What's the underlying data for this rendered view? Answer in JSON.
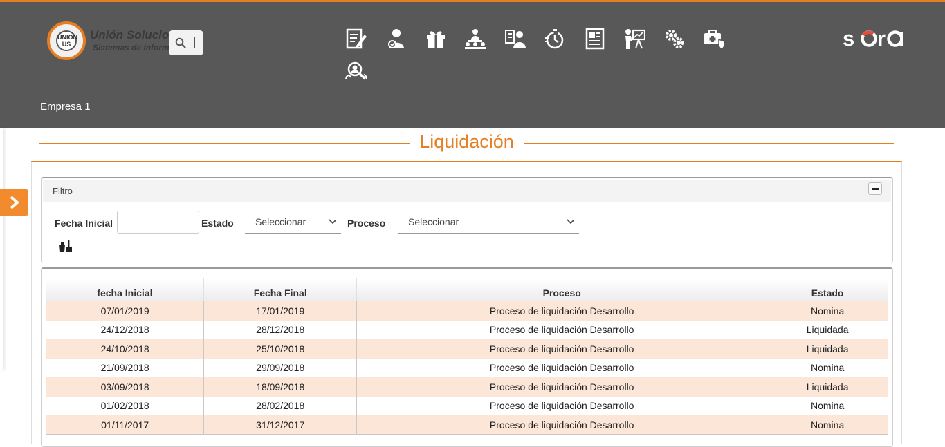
{
  "header": {
    "logo_badge": "UNION US",
    "logo_title": "Unión Soluciones",
    "logo_subtitle": "Sistemas de Información",
    "brand": "sara",
    "company": "Empresa 1"
  },
  "nav_icons": [
    "document-edit-icon",
    "employee-icon",
    "gift-icon",
    "meeting-icon",
    "user-list-icon",
    "stopwatch-icon",
    "report-icon",
    "presentation-icon",
    "settings-gears-icon",
    "medical-briefcase-icon",
    "user-search-icon"
  ],
  "page": {
    "title": "Liquidación"
  },
  "filter": {
    "title": "Filtro",
    "fecha_inicial_label": "Fecha Inicial",
    "fecha_inicial_value": "",
    "estado_label": "Estado",
    "estado_value": "Seleccionar",
    "proceso_label": "Proceso",
    "proceso_value": "Seleccionar"
  },
  "table": {
    "columns": [
      "fecha Inicial",
      "Fecha Final",
      "Proceso",
      "Estado"
    ],
    "rows": [
      [
        "07/01/2019",
        "17/01/2019",
        "Proceso de liquidación Desarrollo",
        "Nomina"
      ],
      [
        "24/12/2018",
        "28/12/2018",
        "Proceso de liquidación Desarrollo",
        "Liquidada"
      ],
      [
        "24/10/2018",
        "25/10/2018",
        "Proceso de liquidación Desarrollo",
        "Liquidada"
      ],
      [
        "21/09/2018",
        "29/09/2018",
        "Proceso de liquidación Desarrollo",
        "Nomina"
      ],
      [
        "03/09/2018",
        "18/09/2018",
        "Proceso de liquidación Desarrollo",
        "Liquidada"
      ],
      [
        "01/02/2018",
        "28/02/2018",
        "Proceso de liquidación Desarrollo",
        "Nomina"
      ],
      [
        "01/11/2017",
        "31/12/2017",
        "Proceso de liquidación Desarrollo",
        "Nomina"
      ]
    ]
  },
  "colors": {
    "accent": "#e67e22",
    "header_bg": "#585858",
    "row_alt": "#fbe6d8"
  }
}
